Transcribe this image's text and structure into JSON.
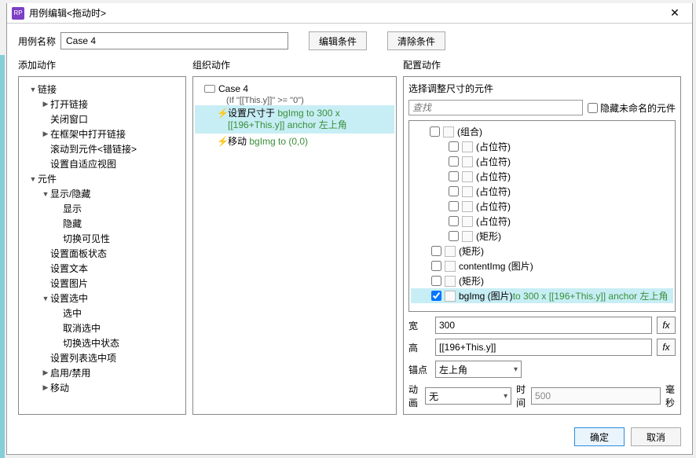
{
  "window": {
    "title": "用例编辑<拖动时>"
  },
  "nameRow": {
    "label": "用例名称",
    "value": "Case 4",
    "editCond": "编辑条件",
    "clearCond": "清除条件"
  },
  "headers": {
    "add": "添加动作",
    "org": "组织动作",
    "cfg": "配置动作"
  },
  "actionsTree": [
    {
      "lvl": 0,
      "arrow": "open",
      "label": "链接"
    },
    {
      "lvl": 1,
      "arrow": "closed",
      "label": "打开链接"
    },
    {
      "lvl": 1,
      "arrow": "none",
      "label": "关闭窗口"
    },
    {
      "lvl": 1,
      "arrow": "closed",
      "label": "在框架中打开链接"
    },
    {
      "lvl": 1,
      "arrow": "none",
      "label": "滚动到元件<错链接>"
    },
    {
      "lvl": 1,
      "arrow": "none",
      "label": "设置自适应视图"
    },
    {
      "lvl": 0,
      "arrow": "open",
      "label": "元件"
    },
    {
      "lvl": 1,
      "arrow": "open",
      "label": "显示/隐藏"
    },
    {
      "lvl": 2,
      "arrow": "none",
      "label": "显示"
    },
    {
      "lvl": 2,
      "arrow": "none",
      "label": "隐藏"
    },
    {
      "lvl": 2,
      "arrow": "none",
      "label": "切换可见性"
    },
    {
      "lvl": 1,
      "arrow": "none",
      "label": "设置面板状态"
    },
    {
      "lvl": 1,
      "arrow": "none",
      "label": "设置文本"
    },
    {
      "lvl": 1,
      "arrow": "none",
      "label": "设置图片"
    },
    {
      "lvl": 1,
      "arrow": "open",
      "label": "设置选中"
    },
    {
      "lvl": 2,
      "arrow": "none",
      "label": "选中"
    },
    {
      "lvl": 2,
      "arrow": "none",
      "label": "取消选中"
    },
    {
      "lvl": 2,
      "arrow": "none",
      "label": "切换选中状态"
    },
    {
      "lvl": 1,
      "arrow": "none",
      "label": "设置列表选中项"
    },
    {
      "lvl": 1,
      "arrow": "closed",
      "label": "启用/禁用"
    },
    {
      "lvl": 1,
      "arrow": "closed",
      "label": "移动"
    }
  ],
  "caseBlock": {
    "caseName": "Case 4",
    "cond": "(If \"[[This.y]]\" >= \"0\")",
    "action1_prefix": "设置尺寸于",
    "action1_green": " bgImg to 300 x [[196+This.y]] anchor 左上角",
    "action2_prefix": "移动",
    "action2_green": " bgImg to (0,0)"
  },
  "cfg": {
    "sectionTitle": "选择调整尺寸的元件",
    "searchPlaceholder": "查找",
    "hideLabel": "隐藏未命名的元件",
    "tree": [
      {
        "pad": "wpad-root",
        "arrow": "open",
        "chk": false,
        "label": "(组合)"
      },
      {
        "pad": "wpad1",
        "arrow": "none",
        "chk": false,
        "label": "(占位符)"
      },
      {
        "pad": "wpad1",
        "arrow": "none",
        "chk": false,
        "label": "(占位符)"
      },
      {
        "pad": "wpad1",
        "arrow": "none",
        "chk": false,
        "label": "(占位符)"
      },
      {
        "pad": "wpad1",
        "arrow": "none",
        "chk": false,
        "label": "(占位符)"
      },
      {
        "pad": "wpad1",
        "arrow": "none",
        "chk": false,
        "label": "(占位符)"
      },
      {
        "pad": "wpad1",
        "arrow": "none",
        "chk": false,
        "label": "(占位符)"
      },
      {
        "pad": "wpad1",
        "arrow": "none",
        "chk": false,
        "label": "(矩形)"
      },
      {
        "pad": "wpad3",
        "arrow": "none",
        "chk": false,
        "label": "(矩形)"
      },
      {
        "pad": "wpad3",
        "arrow": "none",
        "chk": false,
        "label": "contentImg (图片)"
      },
      {
        "pad": "wpad3",
        "arrow": "none",
        "chk": false,
        "label": "(矩形)"
      }
    ],
    "selItem": {
      "pad": "wpad3",
      "chk": true,
      "prefix": "bgImg (图片)",
      "suffix": " to 300 x [[196+This.y]] anchor 左上角"
    },
    "widthLbl": "宽",
    "widthVal": "300",
    "heightLbl": "高",
    "heightVal": "[[196+This.y]]",
    "anchorLbl": "锚点",
    "anchorVal": "左上角",
    "animLbl": "动画",
    "animVal": "无",
    "timeLbl": "时间",
    "timeVal": "500",
    "msLbl": "毫秒",
    "fx": "fx"
  },
  "footer": {
    "ok": "确定",
    "cancel": "取消"
  }
}
